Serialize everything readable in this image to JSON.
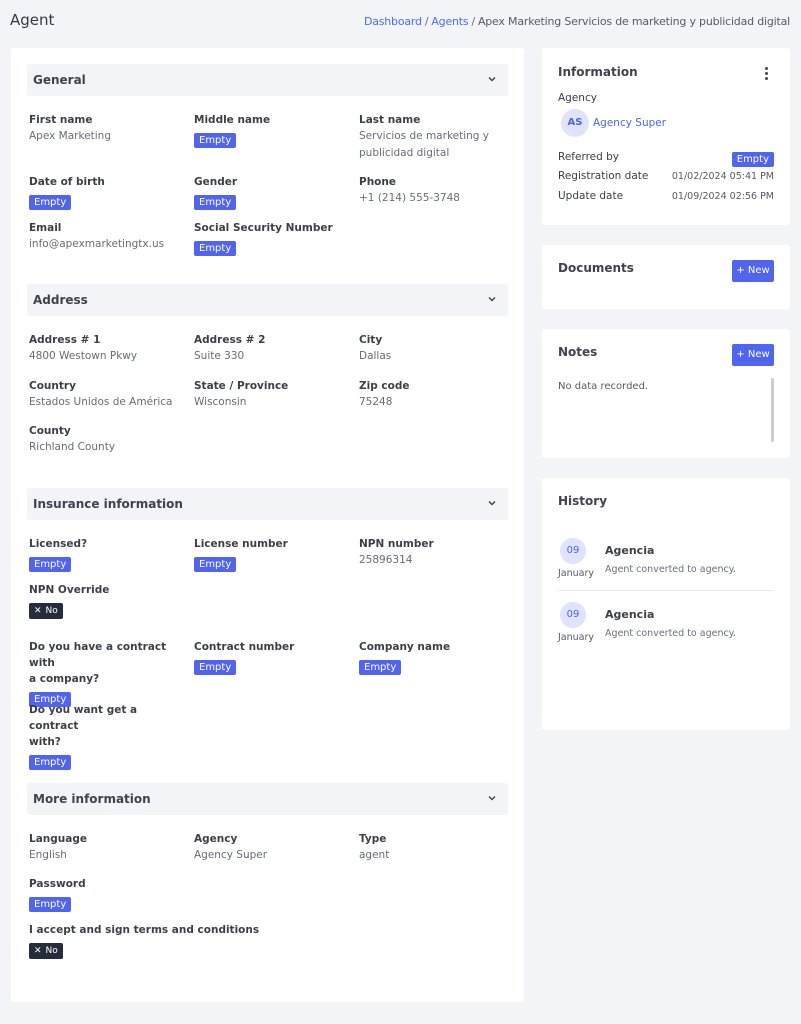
{
  "page": {
    "title": "Agent"
  },
  "breadcrumb": {
    "dashboard": "Dashboard",
    "agents": "Agents",
    "current": "Apex Marketing Servicios de marketing y publicidad digital",
    "sep": "/"
  },
  "empty_label": "Empty",
  "no_label": "No",
  "general": {
    "title": "General",
    "first_name": {
      "label": "First name",
      "value": "Apex Marketing"
    },
    "middle_name": {
      "label": "Middle name"
    },
    "last_name": {
      "label": "Last name",
      "value_line1": "Servicios de marketing y",
      "value_line2": "publicidad digital"
    },
    "dob": {
      "label": "Date of birth"
    },
    "gender": {
      "label": "Gender"
    },
    "phone": {
      "label": "Phone",
      "value": "+1 (214) 555-3748"
    },
    "email": {
      "label": "Email",
      "value": "info@apexmarketingtx.us"
    },
    "ssn": {
      "label": "Social Security Number"
    }
  },
  "address": {
    "title": "Address",
    "address1": {
      "label": "Address # 1",
      "value": "4800 Westown Pkwy"
    },
    "address2": {
      "label": "Address # 2",
      "value": "Suite 330"
    },
    "city": {
      "label": "City",
      "value": "Dallas"
    },
    "country": {
      "label": "Country",
      "value": "Estados Unidos de América"
    },
    "state": {
      "label": "State / Province",
      "value": "Wisconsin"
    },
    "zip": {
      "label": "Zip code",
      "value": "75248"
    },
    "county": {
      "label": "County",
      "value": "Richland County"
    }
  },
  "insurance": {
    "title": "Insurance information",
    "licensed": {
      "label": "Licensed?"
    },
    "license_number": {
      "label": "License number"
    },
    "npn_number": {
      "label": "NPN number",
      "value": "25896314"
    },
    "npn_override": {
      "label": "NPN Override"
    },
    "contract_question": {
      "label_line1": "Do you have a contract with",
      "label_line2": "a company?"
    },
    "contract_number": {
      "label": "Contract number"
    },
    "company_name": {
      "label": "Company name"
    },
    "want_contract": {
      "label_line1": "Do you want get a contract",
      "label_line2": "with?"
    }
  },
  "more": {
    "title": "More information",
    "language": {
      "label": "Language",
      "value": "English"
    },
    "agency": {
      "label": "Agency",
      "value": "Agency Super"
    },
    "type": {
      "label": "Type",
      "value": "agent"
    },
    "password": {
      "label": "Password"
    },
    "terms": {
      "label": "I accept and sign terms and conditions"
    }
  },
  "information": {
    "title": "Information",
    "agency_label": "Agency",
    "agency_initials": "AS",
    "agency_name": "Agency Super",
    "referred_by": "Referred by",
    "registration_date_label": "Registration date",
    "registration_date": "01/02/2024 05:41 PM",
    "update_date_label": "Update date",
    "update_date": "01/09/2024 02:56 PM"
  },
  "documents": {
    "title": "Documents",
    "new_label": "+ New"
  },
  "notes": {
    "title": "Notes",
    "new_label": "+ New",
    "empty_text": "No data recorded."
  },
  "history": {
    "title": "History",
    "items": [
      {
        "day": "09",
        "month": "January",
        "title": "Agencia",
        "desc": "Agent converted to agency."
      },
      {
        "day": "09",
        "month": "January",
        "title": "Agencia",
        "desc": "Agent converted to agency."
      }
    ]
  },
  "colors": {
    "accent": "#5064ee",
    "dark_badge": "#262c3b",
    "link": "#4f6cf0",
    "background": "#f3f4f7"
  },
  "icons": {
    "section_toggle": "chevron-down-icon",
    "close": "close-icon",
    "menu": "more-vertical-icon"
  }
}
